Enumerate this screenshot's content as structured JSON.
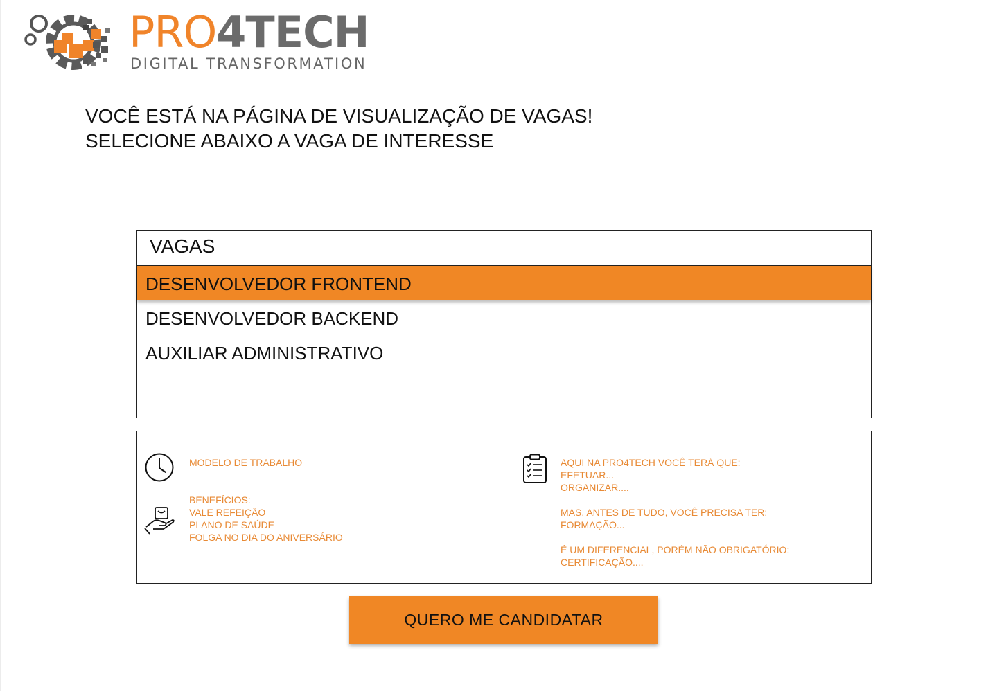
{
  "brand": {
    "name_part1": "PRO",
    "name_part2": "4TECH",
    "tagline": "DIGITAL TRANSFORMATION",
    "color_orange": "#f0842a",
    "color_gray": "#6b6b6b",
    "logo_icon": "gears-pixels-logo"
  },
  "heading": {
    "line1": "VOCÊ ESTÁ NA PÁGINA DE VISUALIZAÇÃO DE VAGAS!",
    "line2": "SELECIONE ABAIXO A VAGA DE INTERESSE"
  },
  "vagas": {
    "header": "VAGAS",
    "items": [
      {
        "label": "DESENVOLVEDOR FRONTEND",
        "selected": true
      },
      {
        "label": "DESENVOLVEDOR BACKEND",
        "selected": false
      },
      {
        "label": "AUXILIAR ADMINISTRATIVO",
        "selected": false
      }
    ],
    "selected_color": "#f08725"
  },
  "details": {
    "text_color": "#e88a35",
    "work_model": {
      "icon": "clock-icon",
      "label": "MODELO DE TRABALHO"
    },
    "benefits": {
      "icon": "hand-gift-icon",
      "lines": [
        "BENEFÍCIOS:",
        "VALE REFEIÇÃO",
        "PLANO DE SAÚDE",
        "FOLGA NO DIA DO ANIVERSÁRIO"
      ]
    },
    "responsibilities": {
      "icon": "clipboard-checklist-icon",
      "lines": [
        "AQUI NA PRO4TECH VOCÊ TERÁ QUE:",
        "EFETUAR...",
        "ORGANIZAR...."
      ]
    },
    "requirements": {
      "lines": [
        "MAS, ANTES DE TUDO, VOCÊ PRECISA TER:",
        "FORMAÇÃO..."
      ]
    },
    "differential": {
      "lines": [
        "É UM DIFERENCIAL, PORÉM NÃO OBRIGATÓRIO:",
        "CERTIFICAÇÃO...."
      ]
    }
  },
  "cta": {
    "label": "QUERO ME CANDIDATAR",
    "color": "#f08725"
  }
}
